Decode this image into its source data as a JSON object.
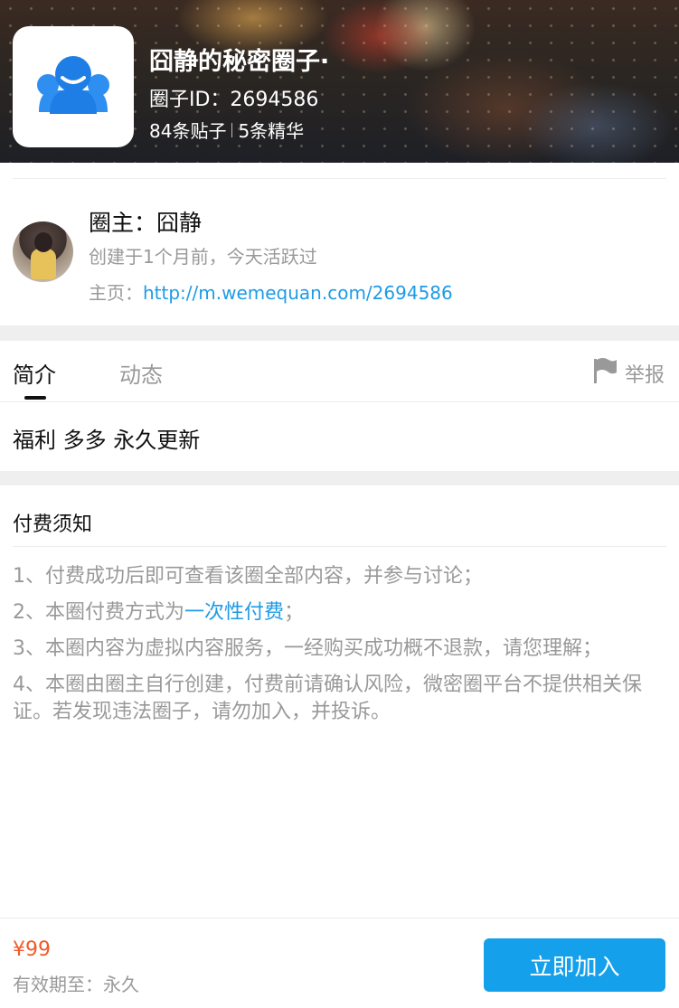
{
  "header": {
    "title": "囧静的秘密圈子·",
    "circle_id": "圈子ID：2694586",
    "posts": "84条贴子",
    "featured": "5条精华",
    "logo_icon": "group-people-icon"
  },
  "owner": {
    "name": "圈主：囧静",
    "created": "创建于1个月前，今天活跃过",
    "home_label": "主页：",
    "home_url": "http://m.wemequan.com/2694586"
  },
  "tabs": [
    {
      "label": "简介",
      "active": true
    },
    {
      "label": "动态",
      "active": false
    }
  ],
  "report": {
    "label": "举报",
    "icon": "flag-icon"
  },
  "intro": "福利 多多 永久更新",
  "notice": {
    "title": "付费须知",
    "items": [
      "1、付费成功后即可查看该圈全部内容，并参与讨论；",
      {
        "prefix": "2、本圈付费方式为",
        "highlight": "一次性付费",
        "suffix": "；"
      },
      "3、本圈内容为虚拟内容服务，一经购买成功概不退款，请您理解；",
      "4、本圈由圈主自行创建，付费前请确认风险，微密圈平台不提供相关保证。若发现违法圈子，请勿加入，并投诉。"
    ]
  },
  "footer": {
    "price": "¥99",
    "validity": "有效期至：永久",
    "join_label": "立即加入"
  },
  "colors": {
    "accent": "#1e9be6",
    "button": "#14a0ea",
    "price": "#f05a28",
    "muted": "#999999"
  }
}
